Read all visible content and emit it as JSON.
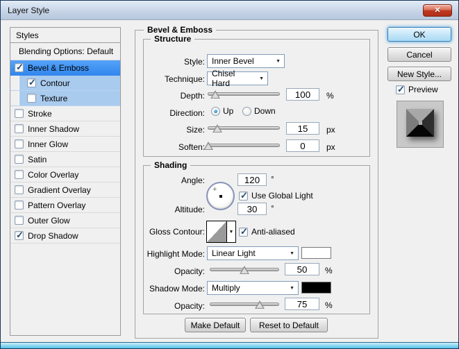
{
  "window": {
    "title": "Layer Style",
    "close_glyph": "✕"
  },
  "glyphs": {
    "dropdown_arrow": "▼",
    "angle_marker": "+"
  },
  "colors": {
    "selected_row": "#3d94f6",
    "sub_selected_row": "#a9cbee",
    "highlight_swatch": "#ffffff",
    "shadow_swatch": "#000000"
  },
  "sidebar": {
    "header": "Styles",
    "items": [
      {
        "label": "Blending Options: Default",
        "checked": null,
        "selected": null,
        "indent": false
      },
      {
        "label": "Bevel & Emboss",
        "checked": true,
        "selected": "primary",
        "indent": false
      },
      {
        "label": "Contour",
        "checked": true,
        "selected": "sub",
        "indent": true
      },
      {
        "label": "Texture",
        "checked": false,
        "selected": "sub",
        "indent": true
      },
      {
        "label": "Stroke",
        "checked": false,
        "selected": null,
        "indent": false
      },
      {
        "label": "Inner Shadow",
        "checked": false,
        "selected": null,
        "indent": false
      },
      {
        "label": "Inner Glow",
        "checked": false,
        "selected": null,
        "indent": false
      },
      {
        "label": "Satin",
        "checked": false,
        "selected": null,
        "indent": false
      },
      {
        "label": "Color Overlay",
        "checked": false,
        "selected": null,
        "indent": false
      },
      {
        "label": "Gradient Overlay",
        "checked": false,
        "selected": null,
        "indent": false
      },
      {
        "label": "Pattern Overlay",
        "checked": false,
        "selected": null,
        "indent": false
      },
      {
        "label": "Outer Glow",
        "checked": false,
        "selected": null,
        "indent": false
      },
      {
        "label": "Drop Shadow",
        "checked": true,
        "selected": null,
        "indent": false
      }
    ]
  },
  "panel": {
    "title": "Bevel & Emboss",
    "structure": {
      "title": "Structure",
      "style_label": "Style:",
      "style_value": "Inner Bevel",
      "technique_label": "Technique:",
      "technique_value": "Chisel Hard",
      "depth_label": "Depth:",
      "depth_value": "100",
      "depth_unit": "%",
      "depth_slider_pct": 11,
      "direction_label": "Direction:",
      "direction_up": "Up",
      "direction_up_selected": true,
      "direction_down": "Down",
      "direction_down_selected": false,
      "size_label": "Size:",
      "size_value": "15",
      "size_unit": "px",
      "size_slider_pct": 13,
      "soften_label": "Soften:",
      "soften_value": "0",
      "soften_unit": "px",
      "soften_slider_pct": 1
    },
    "shading": {
      "title": "Shading",
      "angle_label": "Angle:",
      "angle_value": "120",
      "angle_unit": "°",
      "use_global_light_label": "Use Global Light",
      "use_global_light_checked": true,
      "altitude_label": "Altitude:",
      "altitude_value": "30",
      "altitude_unit": "°",
      "gloss_label": "Gloss Contour:",
      "anti_aliased_label": "Anti-aliased",
      "anti_aliased_checked": true,
      "highlight_mode_label": "Highlight Mode:",
      "highlight_mode_value": "Linear Light",
      "highlight_color": "#ffffff",
      "opacity1_label": "Opacity:",
      "opacity1_value": "50",
      "opacity1_unit": "%",
      "opacity1_slider_pct": 50,
      "shadow_mode_label": "Shadow Mode:",
      "shadow_mode_value": "Multiply",
      "shadow_color": "#000000",
      "opacity2_label": "Opacity:",
      "opacity2_value": "75",
      "opacity2_unit": "%",
      "opacity2_slider_pct": 72
    },
    "footer": {
      "make_default": "Make Default",
      "reset_default": "Reset to Default"
    }
  },
  "actions": {
    "ok": "OK",
    "cancel": "Cancel",
    "new_style": "New Style...",
    "preview_label": "Preview",
    "preview_checked": true
  }
}
